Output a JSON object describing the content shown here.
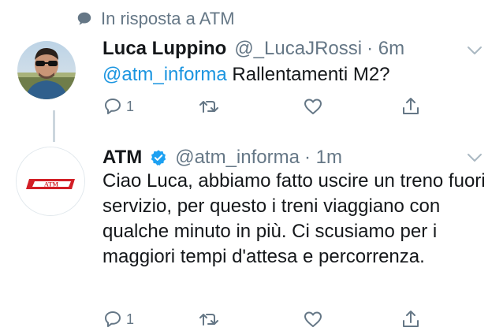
{
  "reply_context": {
    "text": "In risposta a ATM",
    "icon": "speech-bubble-icon"
  },
  "tweets": [
    {
      "name": "Luca Luppino",
      "handle": "@_LucaJRossi",
      "time": "· 6m",
      "verified": false,
      "mention": "@atm_informa",
      "text": " Rallentamenti M2?",
      "reply_count": "1",
      "avatar": "user-photo-sunglasses"
    },
    {
      "name": "ATM",
      "handle": "@atm_informa",
      "time": "· 1m",
      "verified": true,
      "text": "Ciao Luca, abbiamo fatto uscire un treno fuori servizio, per questo i treni viaggiano con qualche minuto in più. Ci scusiamo per i maggiori tempi d'attesa e percorrenza.",
      "reply_count": "1",
      "avatar_logo_text": "ATM"
    }
  ],
  "icons": {
    "reply": "reply-icon",
    "retweet": "retweet-icon",
    "like": "heart-icon",
    "share": "share-icon",
    "menu": "chevron-down-icon",
    "verified": "verified-badge-icon"
  },
  "colors": {
    "link": "#1b95e0",
    "secondary": "#657786",
    "text": "#14171a",
    "verified": "#1da1f2",
    "atm_red": "#d21f26"
  }
}
